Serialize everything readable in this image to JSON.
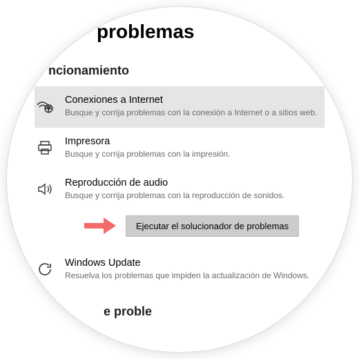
{
  "page": {
    "title": "problemas"
  },
  "section": {
    "title": "ncionamiento"
  },
  "items": {
    "internet": {
      "title": "Conexiones a Internet",
      "desc": "Busque y corrija problemas con la conexión a Internet o a sitios web."
    },
    "printer": {
      "title": "Impresora",
      "desc": "Busque y corrija problemas con la impresión."
    },
    "audio": {
      "title": "Reproducción de audio",
      "desc": "Busque y corrija problemas con la reproducción de sonidos."
    },
    "update": {
      "title": "Windows Update",
      "desc": "Resuelva los problemas que impiden la actualización de Windows."
    }
  },
  "action": {
    "run_label": "Ejecutar el solucionador de problemas"
  },
  "bottom": {
    "partial": "e proble"
  }
}
